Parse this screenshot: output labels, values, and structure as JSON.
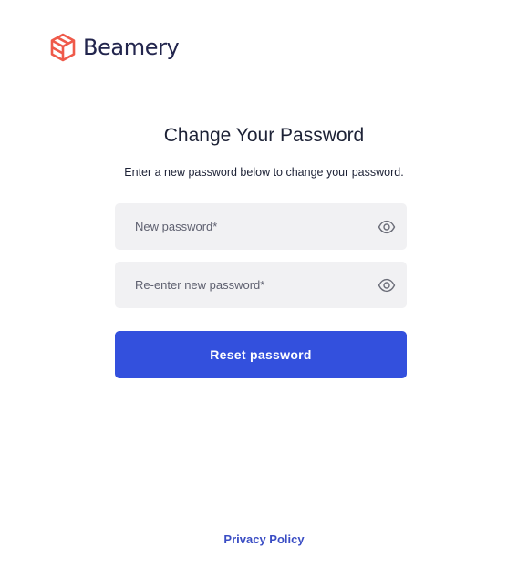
{
  "brand": {
    "name": "Beamery",
    "logo_icon": "beamery-logo-icon",
    "logo_color": "#ef5a4a",
    "text_color": "#22254d"
  },
  "form": {
    "title": "Change Your Password",
    "subtitle": "Enter a new password below to change your password.",
    "new_password": {
      "placeholder": "New password*",
      "value": "",
      "icon": "eye-icon"
    },
    "confirm_password": {
      "placeholder": "Re-enter new password*",
      "value": "",
      "icon": "eye-icon"
    },
    "submit_label": "Reset password",
    "submit_color": "#3350dd"
  },
  "footer": {
    "privacy_label": "Privacy Policy",
    "link_color": "#3a4dc4"
  }
}
